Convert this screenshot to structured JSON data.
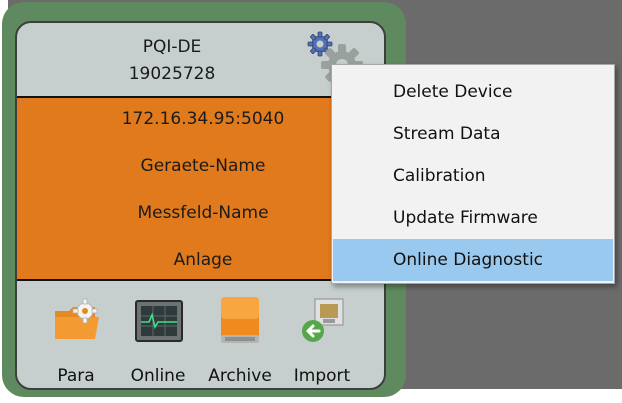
{
  "device": {
    "model": "PQI-DE",
    "serial": "19025728",
    "ip_port": "172.16.34.95:5040",
    "device_name": "Geraete-Name",
    "field_name": "Messfeld-Name",
    "plant": "Anlage"
  },
  "tools": [
    {
      "label": "Para",
      "icon": "parameter-folder-gear-icon"
    },
    {
      "label": "Online",
      "icon": "online-monitor-icon"
    },
    {
      "label": "Archive",
      "icon": "archive-drive-icon"
    },
    {
      "label": "Import",
      "icon": "import-arrow-icon"
    }
  ],
  "context_menu": {
    "items": [
      {
        "label": "Delete Device"
      },
      {
        "label": "Stream Data"
      },
      {
        "label": "Calibration"
      },
      {
        "label": "Update Firmware"
      },
      {
        "label": "Online Diagnostic",
        "highlighted": true
      }
    ]
  },
  "colors": {
    "card_background": "#c6cfcd",
    "info_panel_orange": "#e07a1c",
    "frame_green": "#5f8a5f",
    "menu_highlight": "#99c9ef"
  }
}
